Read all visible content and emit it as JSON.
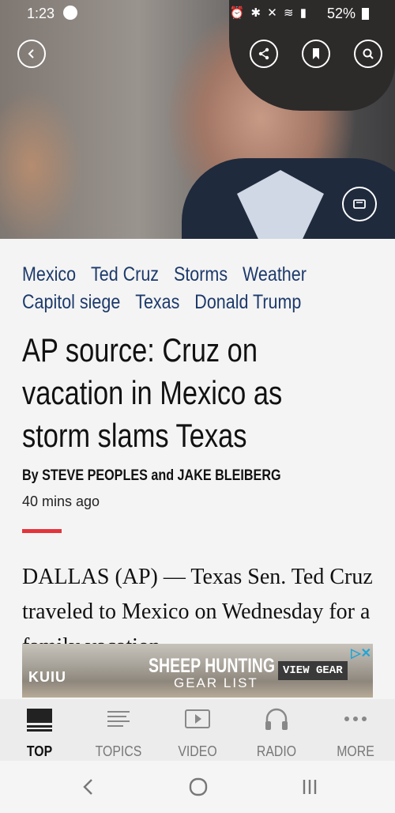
{
  "status": {
    "time": "1:23",
    "battery": "52%"
  },
  "article": {
    "tags": [
      "Mexico",
      "Ted Cruz",
      "Storms",
      "Weather",
      "Capitol siege",
      "Texas",
      "Donald Trump"
    ],
    "headline": "AP source: Cruz on vacation in Mexico as storm slams Texas",
    "byline": "By STEVE PEOPLES and JAKE BLEIBERG",
    "time_ago": "40 mins ago",
    "body": "DALLAS (AP) — Texas Sen. Ted Cruz traveled to Mexico on Wednesday for a family vacation"
  },
  "ad": {
    "brand": "KUIU",
    "title": "SHEEP HUNTING",
    "subtitle": "GEAR LIST",
    "cta": "VIEW GEAR"
  },
  "tabs": [
    {
      "label": "TOP",
      "icon": "top-news-icon"
    },
    {
      "label": "TOPICS",
      "icon": "topics-list-icon"
    },
    {
      "label": "VIDEO",
      "icon": "video-icon"
    },
    {
      "label": "RADIO",
      "icon": "headphones-icon"
    },
    {
      "label": "MORE",
      "icon": "more-dots-icon"
    }
  ],
  "colors": {
    "accent_red": "#e5333c",
    "tag_blue": "#1d3a6b"
  }
}
